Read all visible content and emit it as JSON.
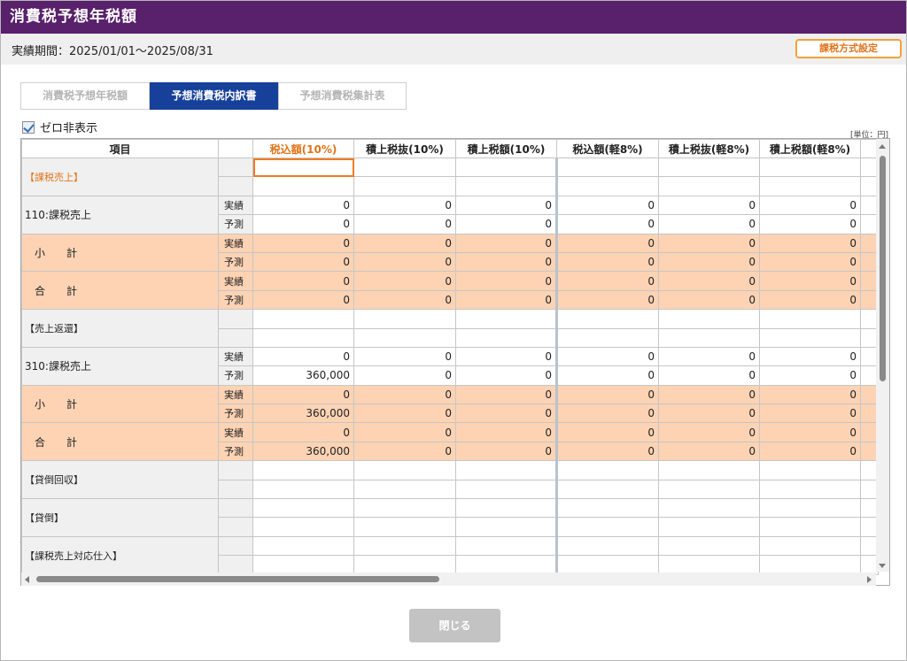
{
  "window": {
    "title": "消費税予想年税額",
    "period": "実績期間：2025/01/01～2025/08/31",
    "tax_method_button": "課税方式設定"
  },
  "tabs": [
    {
      "label": "消費税予想年税額",
      "active": false
    },
    {
      "label": "予想消費税内訳書",
      "active": true
    },
    {
      "label": "予想消費税集計表",
      "active": false
    }
  ],
  "zero_hide": {
    "label": "ゼロ非表示",
    "checked": true
  },
  "unit_label": "[単位：円]",
  "table": {
    "headers": [
      "項目",
      "",
      "税込額(10%)",
      "積上税抜(10%)",
      "積上税額(10%)",
      "税込額(軽8%)",
      "積上税抜(軽8%)",
      "積上税額(軽8%)"
    ],
    "groups": [
      {
        "label": "【課税売上】",
        "type": "section",
        "color": "orange",
        "rows": [
          {
            "kind": "",
            "values": [
              "",
              "",
              "",
              "",
              "",
              ""
            ]
          },
          {
            "kind": "",
            "values": [
              "",
              "",
              "",
              "",
              "",
              ""
            ]
          }
        ]
      },
      {
        "label": "110:課税売上",
        "type": "item",
        "rows": [
          {
            "kind": "実績",
            "values": [
              "0",
              "0",
              "0",
              "0",
              "0",
              "0"
            ]
          },
          {
            "kind": "予測",
            "values": [
              "0",
              "0",
              "0",
              "0",
              "0",
              "0"
            ]
          }
        ]
      },
      {
        "label": "小　　計",
        "type": "subtotal",
        "rows": [
          {
            "kind": "実績",
            "values": [
              "0",
              "0",
              "0",
              "0",
              "0",
              "0"
            ]
          },
          {
            "kind": "予測",
            "values": [
              "0",
              "0",
              "0",
              "0",
              "0",
              "0"
            ]
          }
        ]
      },
      {
        "label": "合　　計",
        "type": "subtotal",
        "rows": [
          {
            "kind": "実績",
            "values": [
              "0",
              "0",
              "0",
              "0",
              "0",
              "0"
            ]
          },
          {
            "kind": "予測",
            "values": [
              "0",
              "0",
              "0",
              "0",
              "0",
              "0"
            ]
          }
        ]
      },
      {
        "label": "【売上返還】",
        "type": "section",
        "rows": [
          {
            "kind": "",
            "values": [
              "",
              "",
              "",
              "",
              "",
              ""
            ]
          },
          {
            "kind": "",
            "values": [
              "",
              "",
              "",
              "",
              "",
              ""
            ]
          }
        ]
      },
      {
        "label": "310:課税売上",
        "type": "item",
        "rows": [
          {
            "kind": "実績",
            "values": [
              "0",
              "0",
              "0",
              "0",
              "0",
              "0"
            ]
          },
          {
            "kind": "予測",
            "values": [
              "360,000",
              "0",
              "0",
              "0",
              "0",
              "0"
            ]
          }
        ]
      },
      {
        "label": "小　　計",
        "type": "subtotal",
        "rows": [
          {
            "kind": "実績",
            "values": [
              "0",
              "0",
              "0",
              "0",
              "0",
              "0"
            ]
          },
          {
            "kind": "予測",
            "values": [
              "360,000",
              "0",
              "0",
              "0",
              "0",
              "0"
            ]
          }
        ]
      },
      {
        "label": "合　　計",
        "type": "subtotal",
        "rows": [
          {
            "kind": "実績",
            "values": [
              "0",
              "0",
              "0",
              "0",
              "0",
              "0"
            ]
          },
          {
            "kind": "予測",
            "values": [
              "360,000",
              "0",
              "0",
              "0",
              "0",
              "0"
            ]
          }
        ]
      },
      {
        "label": "【貸倒回収】",
        "type": "section",
        "rows": [
          {
            "kind": "",
            "values": [
              "",
              "",
              "",
              "",
              "",
              ""
            ]
          },
          {
            "kind": "",
            "values": [
              "",
              "",
              "",
              "",
              "",
              ""
            ]
          }
        ]
      },
      {
        "label": "【貸倒】",
        "type": "section",
        "rows": [
          {
            "kind": "",
            "values": [
              "",
              "",
              "",
              "",
              "",
              ""
            ]
          },
          {
            "kind": "",
            "values": [
              "",
              "",
              "",
              "",
              "",
              ""
            ]
          }
        ]
      },
      {
        "label": "【課税売上対応仕入】",
        "type": "section",
        "rows": [
          {
            "kind": "",
            "values": [
              "",
              "",
              "",
              "",
              "",
              ""
            ]
          },
          {
            "kind": "",
            "values": [
              "",
              "",
              "",
              "",
              "",
              ""
            ]
          }
        ]
      }
    ]
  },
  "close_button": "閉じる",
  "colors": {
    "title_bar": "#59206b",
    "active_tab": "#17409a",
    "subtotal_fill": "#fdd3b4",
    "accent_orange": "#e0741a"
  }
}
